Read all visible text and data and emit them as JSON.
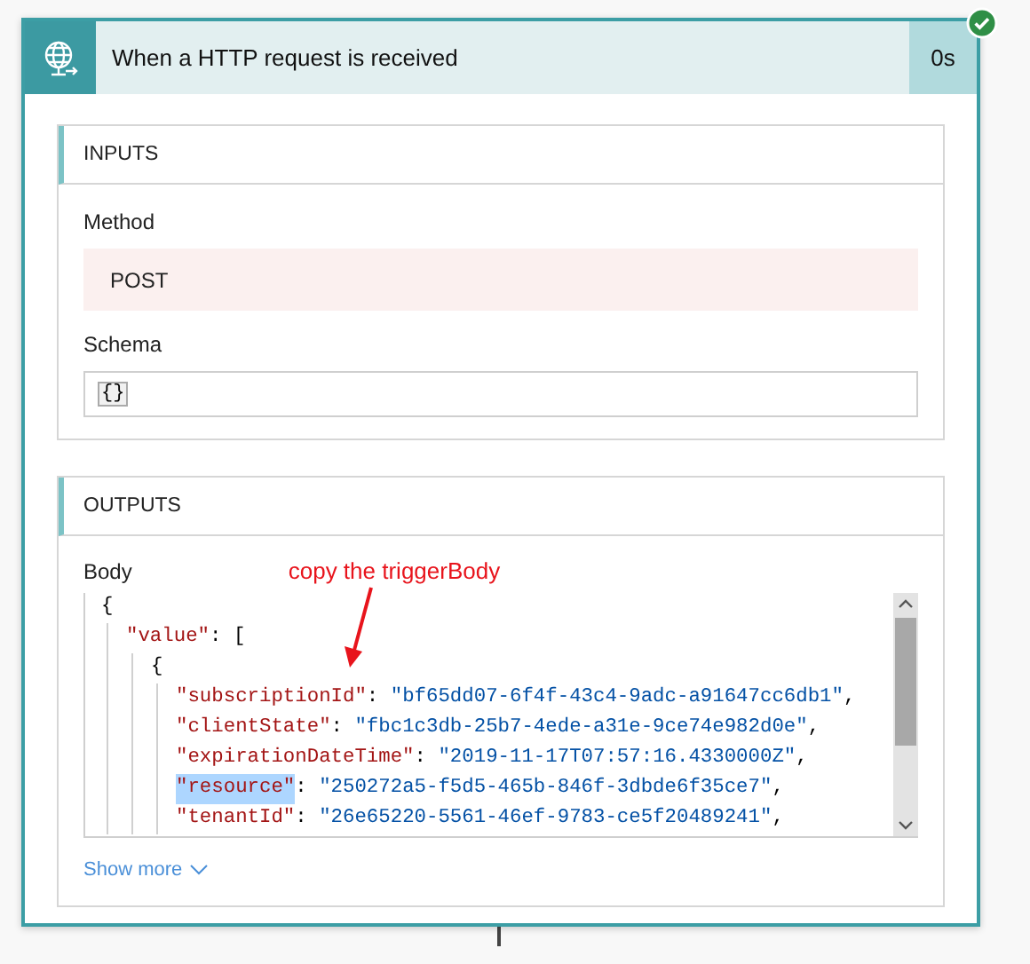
{
  "card": {
    "title": "When a HTTP request is received",
    "duration": "0s",
    "succeeded": true
  },
  "inputs": {
    "heading": "INPUTS",
    "fields": [
      {
        "label": "Method",
        "kind": "value",
        "value": "POST"
      },
      {
        "label": "Schema",
        "kind": "code",
        "value": "{}"
      }
    ]
  },
  "outputs": {
    "heading": "OUTPUTS",
    "label": "Body",
    "annotation": "copy the triggerBody",
    "code": [
      {
        "punct": "{",
        "children": [
          {
            "key": "\"value\"",
            "sep": ": ",
            "punct": "[",
            "children": [
              {
                "punct": "{",
                "children": [
                  {
                    "key": "\"subscriptionId\"",
                    "sep": ": ",
                    "value": "\"bf65dd07-6f4f-43c4-9adc-a91647cc6db1\"",
                    "tail": ",",
                    "selected": false
                  },
                  {
                    "key": "\"clientState\"",
                    "sep": ": ",
                    "value": "\"fbc1c3db-25b7-4ede-a31e-9ce74e982d0e\"",
                    "tail": ",",
                    "selected": false
                  },
                  {
                    "key": "\"expirationDateTime\"",
                    "sep": ": ",
                    "value": "\"2019-11-17T07:57:16.4330000Z\"",
                    "tail": ",",
                    "selected": false
                  },
                  {
                    "key": "\"resource\"",
                    "sep": ": ",
                    "value": "\"250272a5-f5d5-465b-846f-3dbde6f35ce7\"",
                    "tail": ",",
                    "selected": true
                  },
                  {
                    "key": "\"tenantId\"",
                    "sep": ": ",
                    "value": "\"26e65220-5561-46ef-9783-ce5f20489241\"",
                    "tail": ",",
                    "selected": false
                  }
                ]
              }
            ]
          }
        ]
      }
    ],
    "show_more": "Show more"
  }
}
